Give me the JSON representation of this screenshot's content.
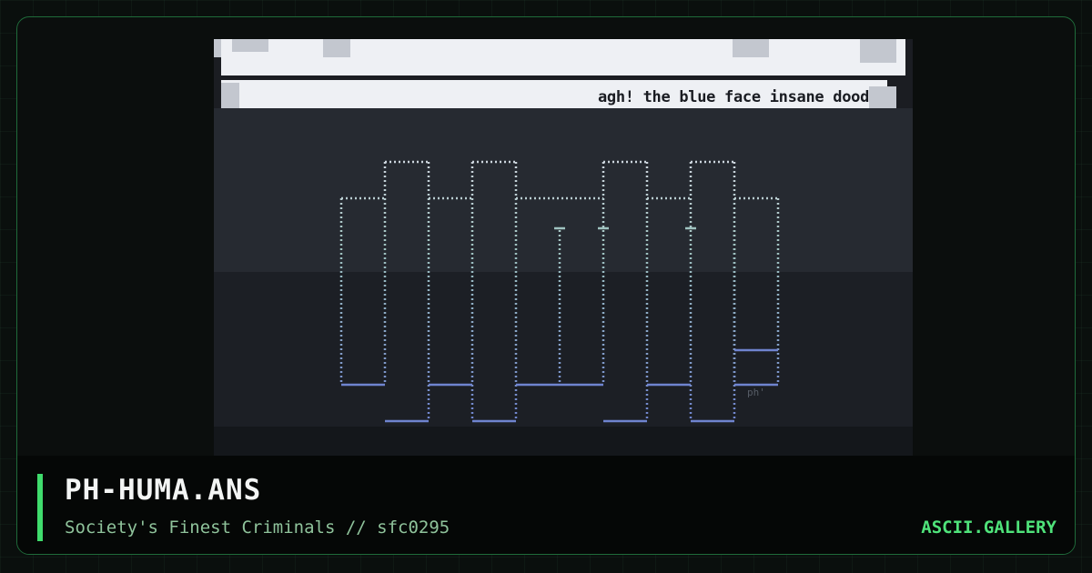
{
  "art": {
    "caption": "agh! the blue face insane dood",
    "tag": "ph'"
  },
  "info": {
    "title": "PH-HUMA.ANS",
    "subtitle": "Society's Finest Criminals // sfc0295",
    "brand": "ASCII.GALLERY"
  },
  "colors": {
    "accent": "#3fdc6c",
    "glyph_top": "#cfd6df",
    "glyph_bottom": "#6f84cf"
  }
}
